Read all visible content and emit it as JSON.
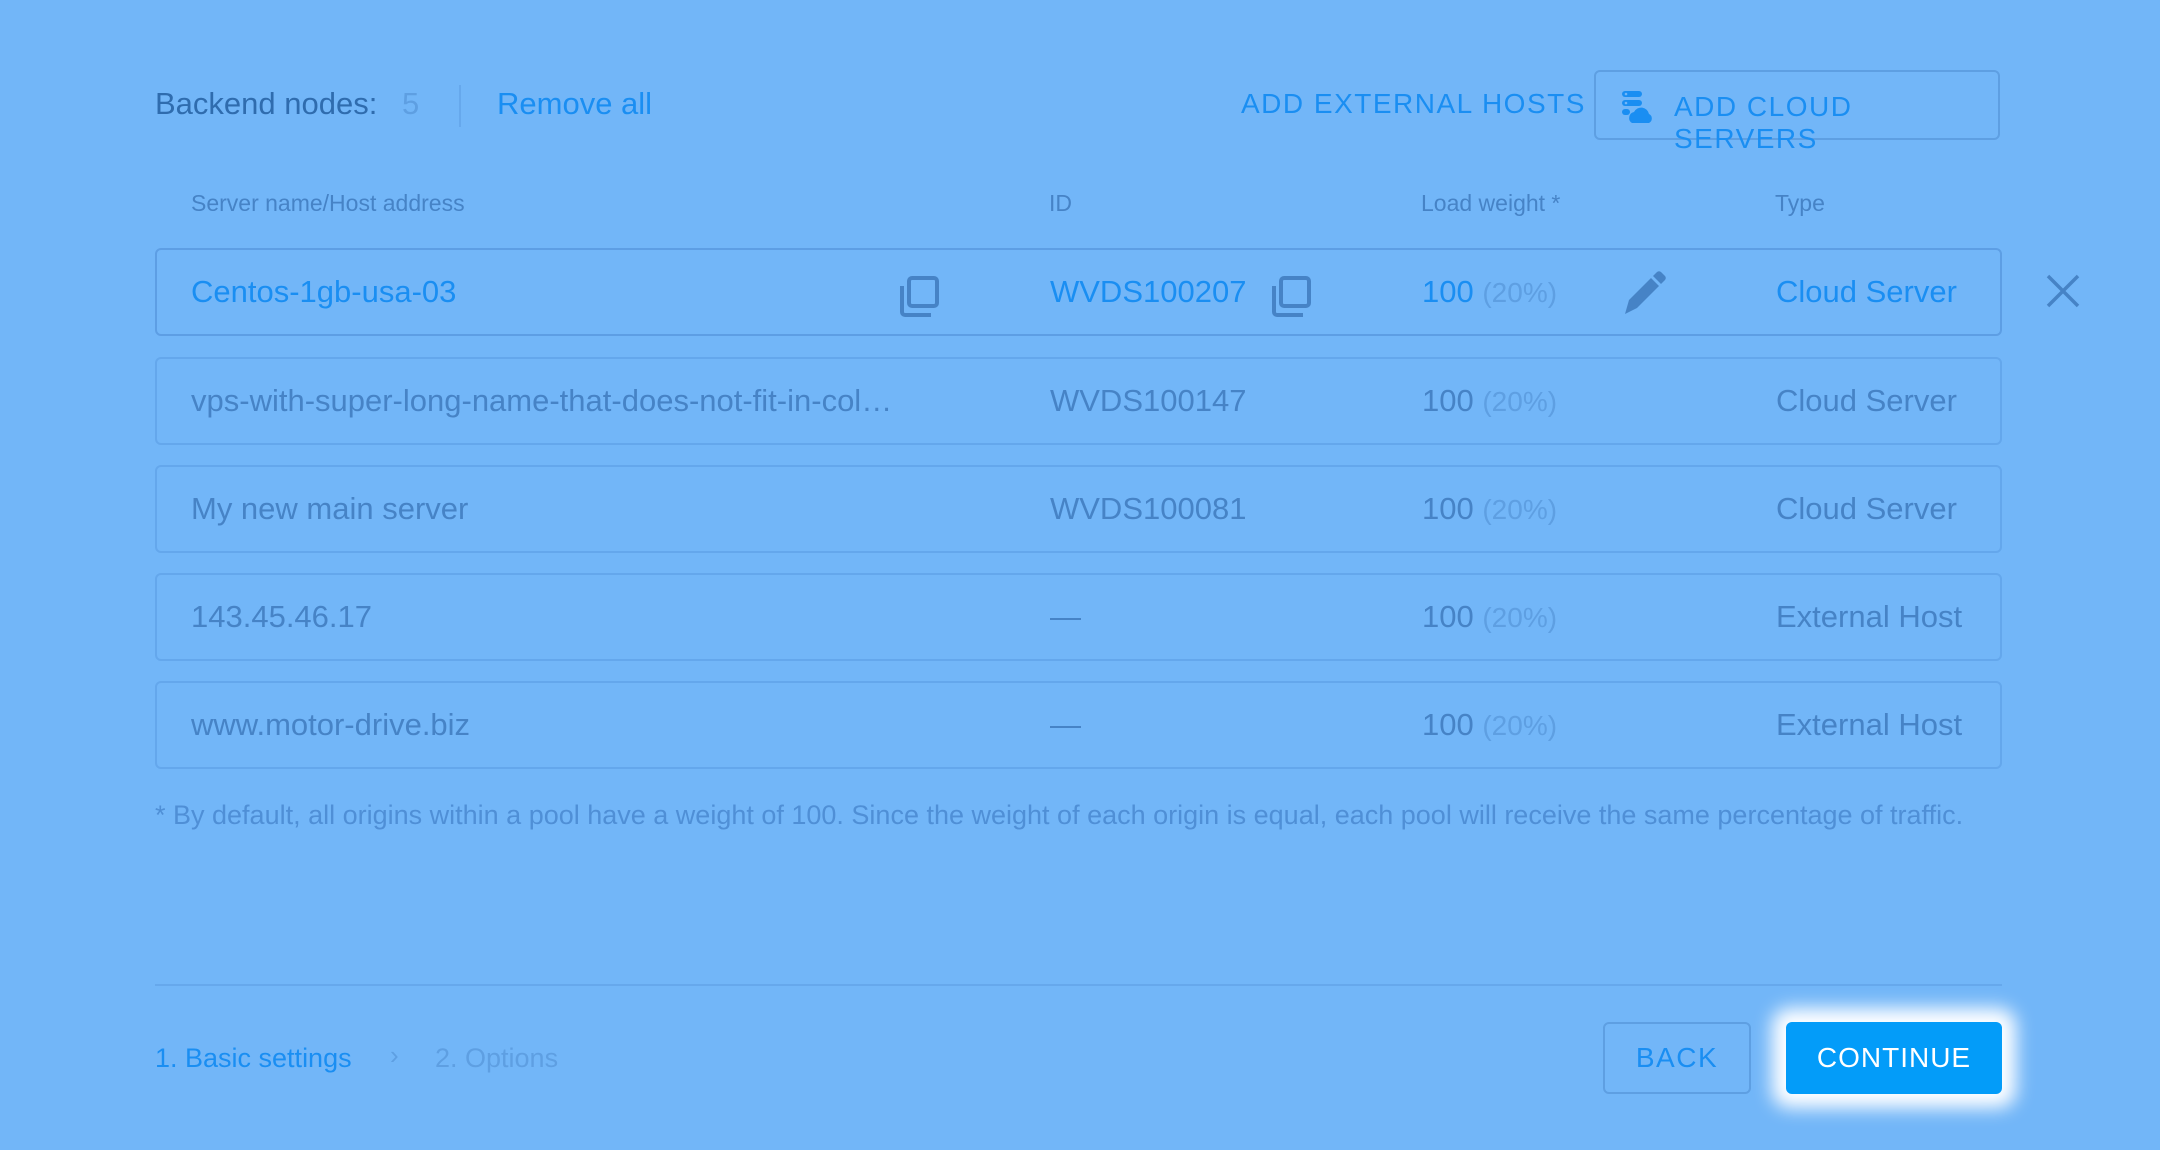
{
  "header": {
    "label": "Backend nodes:",
    "count": "5",
    "remove_all": "Remove all",
    "add_external": "ADD EXTERNAL HOSTS",
    "add_cloud": "ADD CLOUD SERVERS"
  },
  "columns": [
    "Server name/Host address",
    "ID",
    "Load weight *",
    "Type"
  ],
  "rows": [
    {
      "name": "Centos-1gb-usa-03",
      "id": "WVDS100207",
      "weight": "100",
      "pct": "(20%)",
      "type": "Cloud Server",
      "selected": true
    },
    {
      "name": "vps-with-super-long-name-that-does-not-fit-in-col…",
      "id": "WVDS100147",
      "weight": "100",
      "pct": "(20%)",
      "type": "Cloud Server"
    },
    {
      "name": "My new main server",
      "id": "WVDS100081",
      "weight": "100",
      "pct": "(20%)",
      "type": "Cloud Server"
    },
    {
      "name": "143.45.46.17",
      "id": "—",
      "weight": "100",
      "pct": "(20%)",
      "type": "External Host"
    },
    {
      "name": "www.motor-drive.biz",
      "id": "—",
      "weight": "100",
      "pct": "(20%)",
      "type": "External Host"
    }
  ],
  "footnote": "* By default, all origins within a pool have a weight of 100. Since the weight of each origin is equal, each pool will receive the same percentage of traffic.",
  "footer": {
    "step1": "1. Basic settings",
    "step2": "2. Options",
    "back": "BACK",
    "continue": "CONTINUE"
  },
  "colors": {
    "background": "#72b6f8",
    "accent": "#1a8ef2",
    "primary_button": "#039cf9"
  }
}
